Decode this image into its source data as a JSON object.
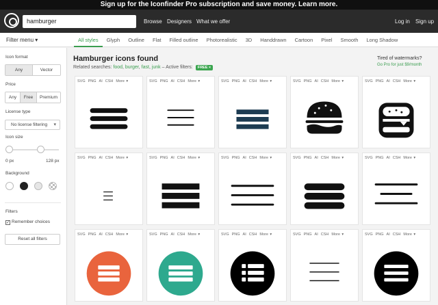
{
  "banner": {
    "text": "Sign up for the Iconfinder Pro subscription and save money. Learn more."
  },
  "header": {
    "search_value": "hamburger",
    "nav": [
      "Browse",
      "Designers",
      "What we offer"
    ],
    "login": "Log in",
    "signup": "Sign up"
  },
  "subnav": {
    "filter_menu": "Filter menu ▾",
    "tabs": [
      "All styles",
      "Glyph",
      "Outline",
      "Flat",
      "Filled outline",
      "Photorealistic",
      "3D",
      "Handdrawn",
      "Cartoon",
      "Pixel",
      "Smooth",
      "Long Shadow"
    ],
    "active_tab": "All styles"
  },
  "sidebar": {
    "icon_format_label": "Icon format",
    "format_options": [
      "Any",
      "Vector"
    ],
    "price_label": "Price",
    "price_options": [
      "Any",
      "Free",
      "Premium"
    ],
    "license_label": "License type",
    "license_value": "No license filtering",
    "size_label": "Icon size",
    "size_min": "0 px",
    "size_max": "128 px",
    "background_label": "Background",
    "filters_label": "Filters",
    "remember_label": "Remember choices",
    "remember_checked": true,
    "reset_label": "Reset all filters"
  },
  "results": {
    "title": "Hamburger icons found",
    "related_prefix": "Related searches:",
    "related_links": [
      "food",
      "burger",
      "fast",
      "junk"
    ],
    "active_filters_label": "– Active filters:",
    "active_filter_badge": "FREE ×",
    "promo_title": "Tired of watermarks?",
    "promo_link": "Go Pro for just $9/month"
  },
  "formats": [
    "SVG",
    "PNG",
    "AI",
    "CSH",
    "More ▾"
  ],
  "icons": [
    {
      "name": "hamburger-menu-thick-bars-icon",
      "color": "#111111"
    },
    {
      "name": "hamburger-menu-thin-bars-icon",
      "color": "#111111"
    },
    {
      "name": "hamburger-menu-navy-bars-icon",
      "color": "#1d3c52"
    },
    {
      "name": "burger-food-icon",
      "color": "#111111"
    },
    {
      "name": "burger-square-icon",
      "color": "#111111"
    },
    {
      "name": "hamburger-menu-small-icon",
      "color": "#111111"
    },
    {
      "name": "hamburger-menu-block-bars-icon",
      "color": "#111111"
    },
    {
      "name": "hamburger-menu-rounded-bars-icon",
      "color": "#111111"
    },
    {
      "name": "hamburger-menu-bold-rounded-icon",
      "color": "#111111"
    },
    {
      "name": "hamburger-menu-staggered-icon",
      "color": "#111111"
    },
    {
      "name": "hamburger-menu-orange-circle-icon",
      "color": "#e9643d"
    },
    {
      "name": "hamburger-menu-teal-circle-icon",
      "color": "#2ea98e"
    },
    {
      "name": "list-menu-black-circle-icon",
      "color": "#000000"
    },
    {
      "name": "hamburger-menu-thin-lines-icon",
      "color": "#111111"
    },
    {
      "name": "hamburger-menu-black-circle-icon",
      "color": "#000000"
    }
  ]
}
